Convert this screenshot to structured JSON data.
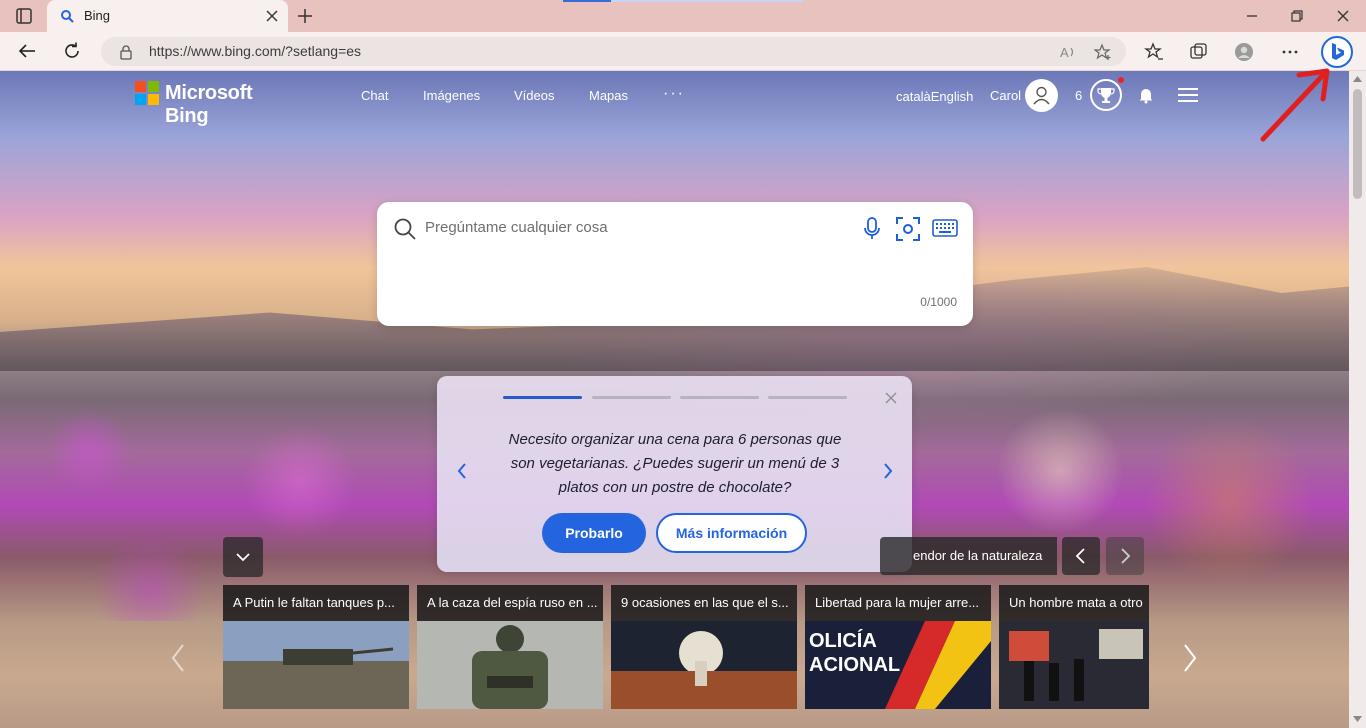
{
  "browser": {
    "tab_title": "Bing",
    "url": "https://www.bing.com/?setlang=es"
  },
  "header": {
    "brand": "Microsoft Bing",
    "nav": [
      "Chat",
      "Imágenes",
      "Vídeos",
      "Mapas"
    ],
    "more": "···",
    "lang": "catalàEnglish",
    "user": "Carol",
    "points": "6"
  },
  "search": {
    "placeholder": "Pregúntame cualquier cosa",
    "counter": "0/1000"
  },
  "prompt_card": {
    "text": "Necesito organizar una cena para 6 personas que son vegetarianas. ¿Puedes sugerir un menú de 3 platos con un postre de chocolate?",
    "try_label": "Probarlo",
    "more_label": "Más información",
    "progress_active_index": 0,
    "step_count": 4
  },
  "image_caption": "endor de la naturaleza",
  "news": [
    {
      "title": "A Putin le faltan tanques p..."
    },
    {
      "title": "A la caza del espía ruso en ..."
    },
    {
      "title": "9 ocasiones en las que el s..."
    },
    {
      "title": "Libertad para la mujer arre..."
    },
    {
      "title": "Un hombre mata a otro"
    }
  ],
  "colors": {
    "accent": "#2464de",
    "tab_bg": "#e8c2bf",
    "annotation_arrow": "#e02020"
  }
}
